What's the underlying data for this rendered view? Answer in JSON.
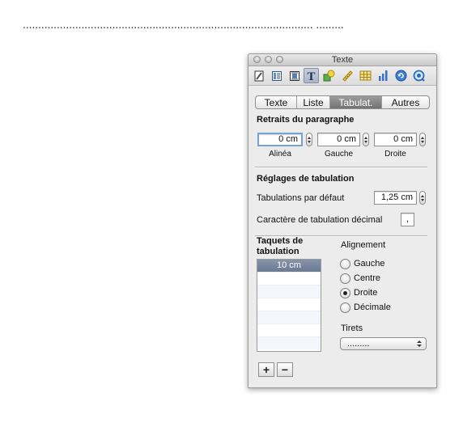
{
  "document": {
    "leader_text": ".............................................................................................. ..........."
  },
  "window": {
    "title": "Texte"
  },
  "toolbar": {
    "tools": [
      {
        "icon": "document-icon"
      },
      {
        "icon": "layout-icon"
      },
      {
        "icon": "wrap-icon"
      },
      {
        "icon": "text-icon",
        "selected": true
      },
      {
        "icon": "graphic-icon"
      },
      {
        "icon": "metrics-icon"
      },
      {
        "icon": "table-icon"
      },
      {
        "icon": "chart-icon"
      },
      {
        "icon": "link-icon"
      },
      {
        "icon": "quicktime-icon"
      }
    ]
  },
  "tabs": [
    {
      "label": "Texte",
      "active": false
    },
    {
      "label": "Liste",
      "active": false
    },
    {
      "label": "Tabulat.",
      "active": true
    },
    {
      "label": "Autres",
      "active": false
    }
  ],
  "indents": {
    "title": "Retraits du paragraphe",
    "first_line": {
      "value": "0 cm",
      "label": "Alinéa"
    },
    "left": {
      "value": "0 cm",
      "label": "Gauche"
    },
    "right": {
      "value": "0 cm",
      "label": "Droite"
    }
  },
  "tab_settings": {
    "title": "Réglages de tabulation",
    "default_label": "Tabulations par défaut",
    "default_value": "1,25 cm",
    "decimal_label": "Caractère de tabulation décimal",
    "decimal_value": ","
  },
  "tab_stops": {
    "title": "Taquets de tabulation",
    "items": [
      "10 cm",
      "",
      "",
      "",
      "",
      "",
      ""
    ]
  },
  "alignment": {
    "title": "Alignement",
    "options": [
      {
        "label": "Gauche",
        "checked": false
      },
      {
        "label": "Centre",
        "checked": false
      },
      {
        "label": "Droite",
        "checked": true
      },
      {
        "label": "Décimale",
        "checked": false
      }
    ]
  },
  "leader": {
    "title": "Tirets",
    "value": "........."
  },
  "buttons": {
    "add": "+",
    "remove": "−"
  },
  "colors": {
    "accent_focus": "#7aa1d4",
    "selection": "#6b7a93",
    "segment_active": "#7d7d7d"
  }
}
